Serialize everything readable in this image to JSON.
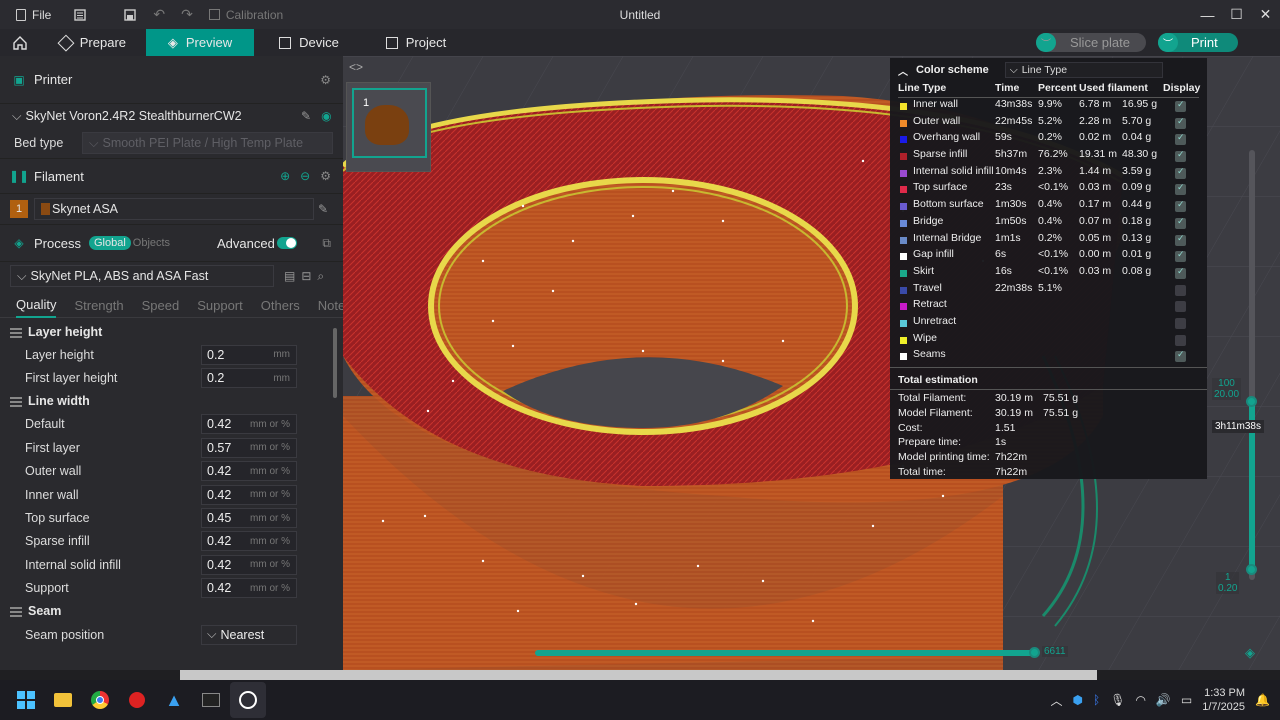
{
  "titlebar": {
    "file_label": "File",
    "calibration_label": "Calibration",
    "window_title": "Untitled"
  },
  "tabs": {
    "prepare": "Prepare",
    "preview": "Preview",
    "device": "Device",
    "project": "Project"
  },
  "actions": {
    "slice_plate": "Slice plate",
    "print": "Print"
  },
  "printer": {
    "section_title": "Printer",
    "selected": "SkyNet Voron2.4R2 StealthburnerCW2",
    "bed_type_label": "Bed type",
    "bed_type_value": "Smooth PEI Plate / High Temp Plate"
  },
  "filament": {
    "section_title": "Filament",
    "slot_number": "1",
    "selected": "Skynet ASA",
    "color": "#8a4a12"
  },
  "process": {
    "section_title": "Process",
    "scope_global": "Global",
    "scope_objects": "Objects",
    "advanced_label": "Advanced",
    "preset": "SkyNet PLA, ABS and ASA Fast",
    "tabs": [
      "Quality",
      "Strength",
      "Speed",
      "Support",
      "Others",
      "Notes"
    ],
    "groups": {
      "layer_height": {
        "title": "Layer height",
        "params": [
          {
            "label": "Layer height",
            "value": "0.2",
            "unit": "mm"
          },
          {
            "label": "First layer height",
            "value": "0.2",
            "unit": "mm"
          }
        ]
      },
      "line_width": {
        "title": "Line width",
        "params": [
          {
            "label": "Default",
            "value": "0.42",
            "unit": "mm or %"
          },
          {
            "label": "First layer",
            "value": "0.57",
            "unit": "mm or %"
          },
          {
            "label": "Outer wall",
            "value": "0.42",
            "unit": "mm or %"
          },
          {
            "label": "Inner wall",
            "value": "0.42",
            "unit": "mm or %"
          },
          {
            "label": "Top surface",
            "value": "0.45",
            "unit": "mm or %"
          },
          {
            "label": "Sparse infill",
            "value": "0.42",
            "unit": "mm or %"
          },
          {
            "label": "Internal solid infill",
            "value": "0.42",
            "unit": "mm or %"
          },
          {
            "label": "Support",
            "value": "0.42",
            "unit": "mm or %"
          }
        ]
      },
      "seam": {
        "title": "Seam",
        "params": [
          {
            "label": "Seam position",
            "value": "Nearest"
          }
        ]
      }
    }
  },
  "plate_thumb": {
    "number": "1"
  },
  "legend": {
    "color_scheme_label": "Color scheme",
    "color_scheme_value": "Line Type",
    "columns": [
      "Line Type",
      "Time",
      "Percent",
      "Used filament",
      "Display"
    ],
    "rows": [
      {
        "name": "Inner wall",
        "color": "#f2e22a",
        "time": "43m38s",
        "percent": "9.9%",
        "length": "6.78 m",
        "weight": "16.95 g",
        "display": true
      },
      {
        "name": "Outer wall",
        "color": "#f08a2a",
        "time": "22m45s",
        "percent": "5.2%",
        "length": "2.28 m",
        "weight": "5.70 g",
        "display": true
      },
      {
        "name": "Overhang wall",
        "color": "#1a1ae8",
        "time": "59s",
        "percent": "0.2%",
        "length": "0.02 m",
        "weight": "0.04 g",
        "display": true
      },
      {
        "name": "Sparse infill",
        "color": "#b0202a",
        "time": "5h37m",
        "percent": "76.2%",
        "length": "19.31 m",
        "weight": "48.30 g",
        "display": true
      },
      {
        "name": "Internal solid infill",
        "color": "#9b4ad0",
        "time": "10m4s",
        "percent": "2.3%",
        "length": "1.44 m",
        "weight": "3.59 g",
        "display": true
      },
      {
        "name": "Top surface",
        "color": "#e02a4a",
        "time": "23s",
        "percent": "<0.1%",
        "length": "0.03 m",
        "weight": "0.09 g",
        "display": true
      },
      {
        "name": "Bottom surface",
        "color": "#6a5ad0",
        "time": "1m30s",
        "percent": "0.4%",
        "length": "0.17 m",
        "weight": "0.44 g",
        "display": true
      },
      {
        "name": "Bridge",
        "color": "#6a8ad8",
        "time": "1m50s",
        "percent": "0.4%",
        "length": "0.07 m",
        "weight": "0.18 g",
        "display": true
      },
      {
        "name": "Internal Bridge",
        "color": "#6a8ac8",
        "time": "1m1s",
        "percent": "0.2%",
        "length": "0.05 m",
        "weight": "0.13 g",
        "display": true
      },
      {
        "name": "Gap infill",
        "color": "#ffffff",
        "time": "6s",
        "percent": "<0.1%",
        "length": "0.00 m",
        "weight": "0.01 g",
        "display": true
      },
      {
        "name": "Skirt",
        "color": "#1aa88a",
        "time": "16s",
        "percent": "<0.1%",
        "length": "0.03 m",
        "weight": "0.08 g",
        "display": true
      },
      {
        "name": "Travel",
        "color": "#3a4aa8",
        "time": "22m38s",
        "percent": "5.1%",
        "length": "",
        "weight": "",
        "display": false
      },
      {
        "name": "Retract",
        "color": "#c81ac8",
        "time": "",
        "percent": "",
        "length": "",
        "weight": "",
        "display": false
      },
      {
        "name": "Unretract",
        "color": "#5ac8d8",
        "time": "",
        "percent": "",
        "length": "",
        "weight": "",
        "display": false
      },
      {
        "name": "Wipe",
        "color": "#f0f02a",
        "time": "",
        "percent": "",
        "length": "",
        "weight": "",
        "display": false
      },
      {
        "name": "Seams",
        "color": "#ffffff",
        "time": "",
        "percent": "",
        "length": "",
        "weight": "",
        "display": true
      }
    ],
    "total_title": "Total estimation",
    "totals": [
      {
        "label": "Total Filament:",
        "v1": "30.19 m",
        "v2": "75.51 g"
      },
      {
        "label": "Model Filament:",
        "v1": "30.19 m",
        "v2": "75.51 g"
      },
      {
        "label": "Cost:",
        "v1": "1.51",
        "v2": ""
      },
      {
        "label": "Prepare time:",
        "v1": "1s",
        "v2": ""
      },
      {
        "label": "Model printing time:",
        "v1": "7h22m",
        "v2": ""
      },
      {
        "label": "Total time:",
        "v1": "7h22m",
        "v2": ""
      }
    ]
  },
  "layer_slider": {
    "top_layer": "100",
    "top_height": "20.00",
    "time_tooltip": "3h11m38s",
    "bottom_layer": "1",
    "bottom_height": "0.20"
  },
  "move_slider": {
    "value": "6611"
  },
  "taskbar": {
    "time": "1:33 PM",
    "date": "1/7/2025"
  }
}
